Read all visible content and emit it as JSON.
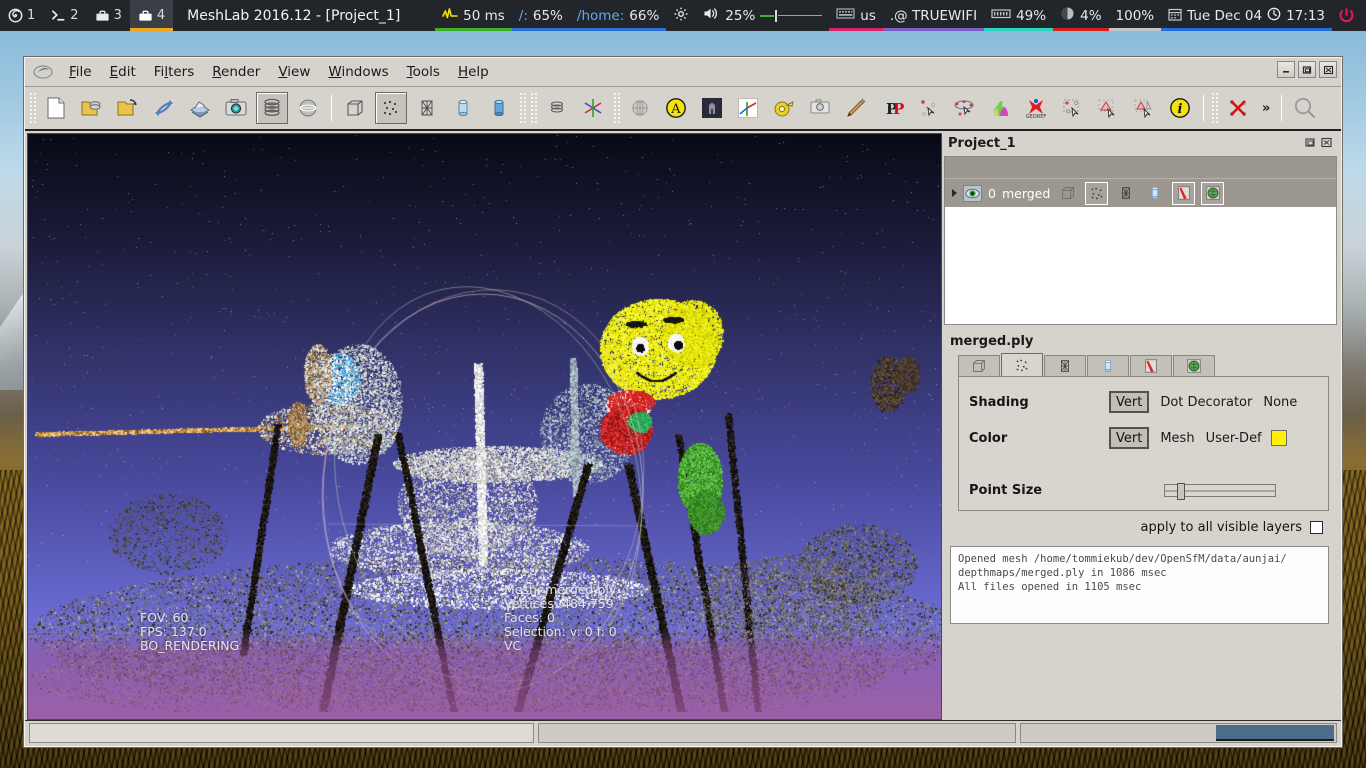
{
  "topbar": {
    "workspaces": [
      {
        "icon": "firefox-icon",
        "num": "1",
        "active": false
      },
      {
        "icon": "terminal-icon",
        "num": "2",
        "active": false
      },
      {
        "icon": "toolbox-icon",
        "num": "3",
        "active": false
      },
      {
        "icon": "toolbox-icon",
        "num": "4",
        "active": true
      }
    ],
    "window_title": "MeshLab 2016.12 - [Project_1]",
    "indicators": {
      "latency": "50 ms",
      "root_disk_label": "/:",
      "root_disk_value": "65%",
      "home_disk_label": "/home:",
      "home_disk_value": "66%",
      "volume": "25%",
      "keyboard_layout": "us",
      "wifi_name": ".@ TRUEWIFI",
      "memory": "49%",
      "cpu": "4%",
      "battery": "100%",
      "date": "Tue Dec 04",
      "time": "17:13"
    }
  },
  "window": {
    "menus": [
      {
        "pre": "",
        "key": "F",
        "post": "ile"
      },
      {
        "pre": "",
        "key": "E",
        "post": "dit"
      },
      {
        "pre": "Fi",
        "key": "l",
        "post": "ters"
      },
      {
        "pre": "",
        "key": "R",
        "post": "ender"
      },
      {
        "pre": "",
        "key": "V",
        "post": "iew"
      },
      {
        "pre": "",
        "key": "W",
        "post": "indows"
      },
      {
        "pre": "",
        "key": "T",
        "post": "ools"
      },
      {
        "pre": "",
        "key": "H",
        "post": "elp"
      }
    ],
    "controls": {
      "minimize": "_",
      "restore": "❐",
      "close": "✖"
    },
    "toolbar_more": "»"
  },
  "toolbar": {
    "buttons": [
      {
        "name": "new-project-icon",
        "checked": false
      },
      {
        "name": "open-project-icon",
        "checked": false
      },
      {
        "name": "open-mesh-icon",
        "checked": false
      },
      {
        "name": "reload-icon",
        "checked": false
      },
      {
        "name": "save-mesh-icon",
        "checked": false
      },
      {
        "name": "snapshot-icon",
        "checked": false
      },
      {
        "name": "show-layer-dialog-icon",
        "checked": true
      },
      {
        "name": "show-trackball-icon",
        "checked": false
      },
      {
        "name": "bbox-render-icon",
        "checked": false
      },
      {
        "name": "points-render-icon",
        "checked": true
      },
      {
        "name": "wireframe-render-icon",
        "checked": false
      },
      {
        "name": "flatlines-render-icon",
        "checked": false
      },
      {
        "name": "smooth-render-icon",
        "checked": false
      },
      {
        "name": "layer-stack-icon",
        "checked": false
      },
      {
        "name": "axis-decorator-icon",
        "checked": false
      },
      {
        "name": "global-render-icon",
        "checked": false
      },
      {
        "name": "texture-param-icon",
        "checked": false
      },
      {
        "name": "quoted-box-icon",
        "checked": false
      },
      {
        "name": "measure-axis-icon",
        "checked": false
      },
      {
        "name": "measuring-tape-icon",
        "checked": false
      },
      {
        "name": "raster-alignment-icon",
        "checked": false
      },
      {
        "name": "paint-brush-icon",
        "checked": false
      },
      {
        "name": "pdf-export-icon",
        "checked": false
      },
      {
        "name": "pick-points-icon",
        "checked": false
      },
      {
        "name": "align-tool-icon",
        "checked": false
      },
      {
        "name": "colorize-bunny-icon",
        "checked": false
      },
      {
        "name": "georeference-icon",
        "checked": false
      },
      {
        "name": "select-vertices-icon",
        "checked": false
      },
      {
        "name": "select-faces-icon",
        "checked": false
      },
      {
        "name": "select-connected-icon",
        "checked": false
      },
      {
        "name": "info-icon",
        "checked": false
      },
      {
        "name": "delete-selection-icon",
        "checked": false
      },
      {
        "name": "search-filter-icon",
        "checked": false
      }
    ]
  },
  "viewport": {
    "left_info": [
      "FOV: 60",
      "FPS:   137.0",
      "BO_RENDERING"
    ],
    "right_info": [
      "Mesh: merged.ply",
      "Vertices: 484,759",
      "Faces: 0",
      "Selection: v: 0 f: 0",
      "VC"
    ]
  },
  "dock": {
    "title": "Project_1",
    "float_icon": "undock-icon",
    "close_icon": "close-icon",
    "layer": {
      "index": "0",
      "name": "merged",
      "visible": true,
      "render_buttons": [
        {
          "name": "bbox-icon",
          "on": false
        },
        {
          "name": "points-icon",
          "on": true
        },
        {
          "name": "wireframe-icon",
          "on": false
        },
        {
          "name": "flat-icon",
          "on": false
        },
        {
          "name": "texture-icon",
          "on": true
        },
        {
          "name": "vertex-color-icon",
          "on": true
        }
      ]
    },
    "mesh_name": "merged.ply",
    "tabs": [
      {
        "name": "tab-bbox",
        "selected": false
      },
      {
        "name": "tab-points",
        "selected": true
      },
      {
        "name": "tab-wireframe",
        "selected": false
      },
      {
        "name": "tab-flat",
        "selected": false
      },
      {
        "name": "tab-texture",
        "selected": false
      },
      {
        "name": "tab-vertex-color",
        "selected": false
      }
    ],
    "panel": {
      "shading_label": "Shading",
      "shading_selected": "Vert",
      "shading_option_1": "Dot Decorator",
      "shading_option_2": "None",
      "color_label": "Color",
      "color_selected": "Vert",
      "color_option_1": "Mesh",
      "color_option_2": "User-Def",
      "color_swatch": "#fff200",
      "point_size_label": "Point Size"
    },
    "apply_all_label": "apply to all visible layers",
    "apply_all_checked": false,
    "log": "Opened mesh /home/tommiekub/dev/OpenSfM/data/aunjai/\ndepthmaps/merged.ply in 1086 msec\nAll files opened in 1105 msec"
  },
  "statusbar": {
    "left_message": "",
    "middle_message": "",
    "progress_visible": true
  },
  "colors": {
    "window_bg": "#d6d3cd",
    "topbar_bg": "#22262b",
    "accent_orange": "#f0a81e",
    "yellow_swatch": "#fff200",
    "progress_blue": "#4c6c8c"
  }
}
